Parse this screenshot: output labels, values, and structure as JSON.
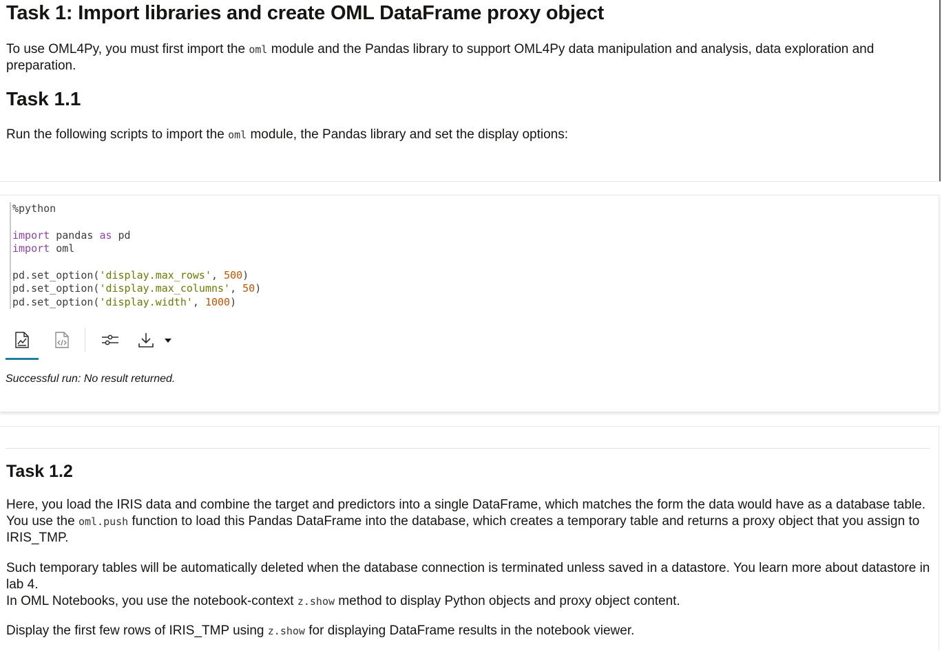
{
  "task1": {
    "title": "Task 1: Import libraries and create OML DataFrame proxy object",
    "intro_a": "To use OML4Py, you must first import the ",
    "intro_code": "oml",
    "intro_b": " module and the Pandas library to support OML4Py data manipulation and analysis, data exploration and preparation."
  },
  "task11": {
    "title": "Task 1.1",
    "text_a": "Run the following scripts to import the ",
    "text_code": "oml",
    "text_b": " module, the Pandas library and set the display options:"
  },
  "code_cell": {
    "line1": "%python",
    "kw_import1": "import",
    "mod_pandas": " pandas ",
    "kw_as": "as",
    "alias": " pd",
    "kw_import2": "import",
    "mod_oml": " oml",
    "call1": "pd.set_option(",
    "arg1": "'display.max_rows'",
    "sep1": ", ",
    "val1": "500",
    "close1": ")",
    "call2": "pd.set_option(",
    "arg2": "'display.max_columns'",
    "sep2": ", ",
    "val2": "50",
    "close2": ")",
    "call3": "pd.set_option(",
    "arg3": "'display.width'",
    "sep3": ", ",
    "val3": "1000",
    "close3": ")",
    "status": "Successful run: No result returned."
  },
  "toolbar_icons": [
    "chart-report-icon",
    "code-file-icon",
    "settings-sliders-icon",
    "download-icon",
    "caret-down-icon"
  ],
  "task12": {
    "title": "Task 1.2",
    "p1_a": "Here, you load the IRIS data and combine the target and predictors into a single DataFrame, which matches the form the data would have as a database table. You use the ",
    "p1_code": "oml.push",
    "p1_b": " function to load this Pandas DataFrame into the database, which creates a temporary table and returns a proxy object that you assign to IRIS_TMP.",
    "p2_line1": "Such temporary tables will be automatically deleted when the database connection is terminated unless saved in a datastore. You learn more about datastore in lab 4.",
    "p2_line2_a": "In OML Notebooks, you use the notebook-context ",
    "p2_line2_code": "z.show",
    "p2_line2_b": " method to display Python objects and proxy object content.",
    "p3_a": "Display the first few rows of IRIS_TMP using ",
    "p3_code": "z.show",
    "p3_b": " for displaying DataFrame results in the notebook viewer."
  },
  "colors": {
    "accent": "#227e9e",
    "keyword": "#8b44a6",
    "string": "#6b7a00",
    "number": "#c45500"
  }
}
